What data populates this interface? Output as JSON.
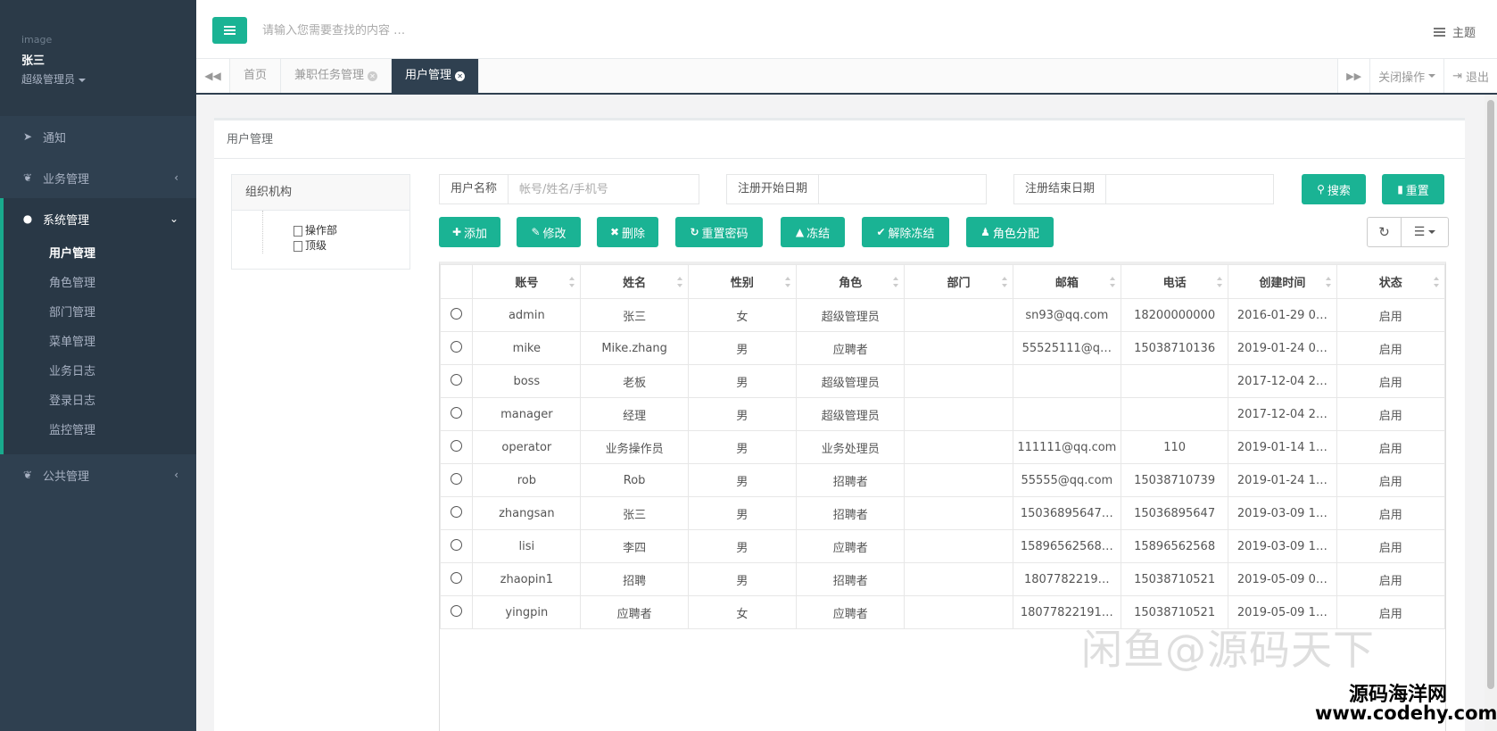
{
  "sidebar": {
    "profile": {
      "image_alt": "image",
      "name": "张三",
      "role": "超级管理员"
    },
    "nav": [
      {
        "label": "通知"
      },
      {
        "label": "业务管理"
      },
      {
        "label": "系统管理"
      },
      {
        "label": "公共管理"
      }
    ],
    "sub_items": [
      {
        "label": "用户管理"
      },
      {
        "label": "角色管理"
      },
      {
        "label": "部门管理"
      },
      {
        "label": "菜单管理"
      },
      {
        "label": "业务日志"
      },
      {
        "label": "登录日志"
      },
      {
        "label": "监控管理"
      }
    ]
  },
  "topbar": {
    "search_placeholder": "请输入您需要查找的内容 …",
    "theme_label": "主题"
  },
  "tabs": [
    {
      "label": "首页"
    },
    {
      "label": "兼职任务管理"
    },
    {
      "label": "用户管理"
    }
  ],
  "tabbar": {
    "close_ops": "关闭操作",
    "logout": "退出"
  },
  "panel": {
    "title": "用户管理",
    "org": {
      "title": "组织机构",
      "nodes": [
        "操作部",
        "顶级"
      ]
    },
    "filters": {
      "username_label": "用户名称",
      "username_placeholder": "帐号/姓名/手机号",
      "start_label": "注册开始日期",
      "end_label": "注册结束日期"
    },
    "buttons": {
      "search": "搜索",
      "reset": "重置",
      "add": "添加",
      "edit": "修改",
      "delete": "删除",
      "reset_pwd": "重置密码",
      "freeze": "冻结",
      "unfreeze": "解除冻结",
      "assign_role": "角色分配"
    }
  },
  "table": {
    "headers": [
      "账号",
      "姓名",
      "性别",
      "角色",
      "部门",
      "邮箱",
      "电话",
      "创建时间",
      "状态"
    ],
    "rows": [
      [
        "admin",
        "张三",
        "女",
        "超级管理员",
        "",
        "sn93@qq.com",
        "18200000000",
        "2016-01-29 0…",
        "启用"
      ],
      [
        "mike",
        "Mike.zhang",
        "男",
        "应聘者",
        "",
        "55525111@q…",
        "15038710136",
        "2019-01-24 0…",
        "启用"
      ],
      [
        "boss",
        "老板",
        "男",
        "超级管理员",
        "",
        "",
        "",
        "2017-12-04 2…",
        "启用"
      ],
      [
        "manager",
        "经理",
        "男",
        "超级管理员",
        "",
        "",
        "",
        "2017-12-04 2…",
        "启用"
      ],
      [
        "operator",
        "业务操作员",
        "男",
        "业务处理员",
        "",
        "111111@qq.com",
        "110",
        "2019-01-14 1…",
        "启用"
      ],
      [
        "rob",
        "Rob",
        "男",
        "招聘者",
        "",
        "55555@qq.com",
        "15038710739",
        "2019-01-24 1…",
        "启用"
      ],
      [
        "zhangsan",
        "张三",
        "男",
        "招聘者",
        "",
        "15036895647…",
        "15036895647",
        "2019-03-09 1…",
        "启用"
      ],
      [
        "lisi",
        "李四",
        "男",
        "应聘者",
        "",
        "15896562568…",
        "15896562568",
        "2019-03-09 1…",
        "启用"
      ],
      [
        "zhaopin1",
        "招聘",
        "男",
        "招聘者",
        "",
        "1807782219…",
        "15038710521",
        "2019-05-09 0…",
        "启用"
      ],
      [
        "yingpin",
        "应聘者",
        "女",
        "应聘者",
        "",
        "18077822191…",
        "15038710521",
        "2019-05-09 1…",
        "启用"
      ]
    ]
  },
  "watermark": {
    "line1": "闲鱼@源码天下",
    "line2": "源码海洋网",
    "line3": "www.codehy.com"
  },
  "colors": {
    "sidebar": "#2f4050",
    "accent": "#1ab394"
  }
}
